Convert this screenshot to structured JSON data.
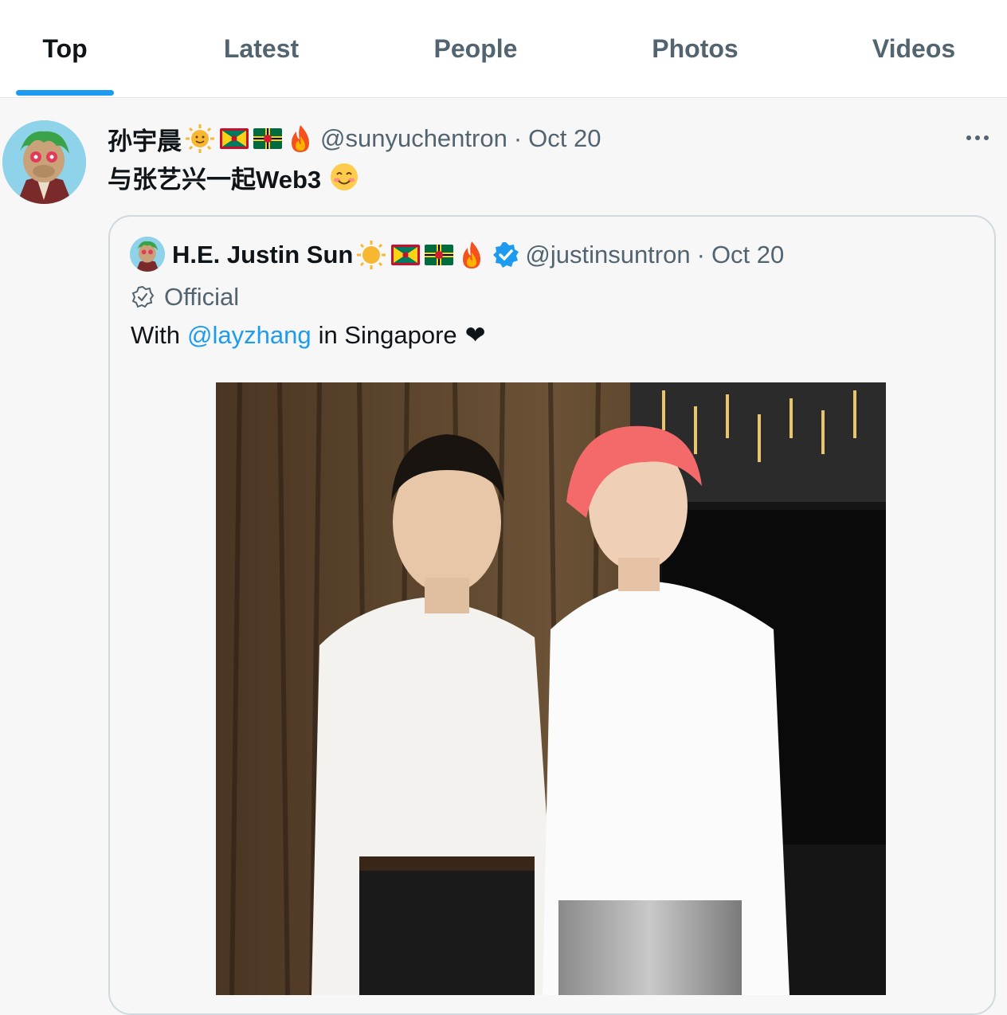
{
  "tabs": [
    {
      "label": "Top",
      "active": true
    },
    {
      "label": "Latest",
      "active": false
    },
    {
      "label": "People",
      "active": false
    },
    {
      "label": "Photos",
      "active": false
    },
    {
      "label": "Videos",
      "active": false
    }
  ],
  "tweet": {
    "display_name": "孙宇晨",
    "handle": "@sunyuchentron",
    "separator": "·",
    "date": "Oct 20",
    "text": "与张艺兴一起Web3",
    "emojis": [
      "sun-emoji",
      "grenada-flag",
      "dominica-flag",
      "fire-emoji"
    ]
  },
  "quoted": {
    "display_name": "H.E. Justin Sun",
    "handle": "@justinsuntron",
    "separator": "·",
    "date": "Oct 20",
    "badge_label": "Official",
    "text_before": "With",
    "mention": "@layzhang",
    "text_after": "in Singapore",
    "heart": "❤"
  },
  "colors": {
    "accent": "#1d9bf0",
    "muted": "#536471",
    "text": "#0f1419",
    "background": "#f7f7f7"
  }
}
